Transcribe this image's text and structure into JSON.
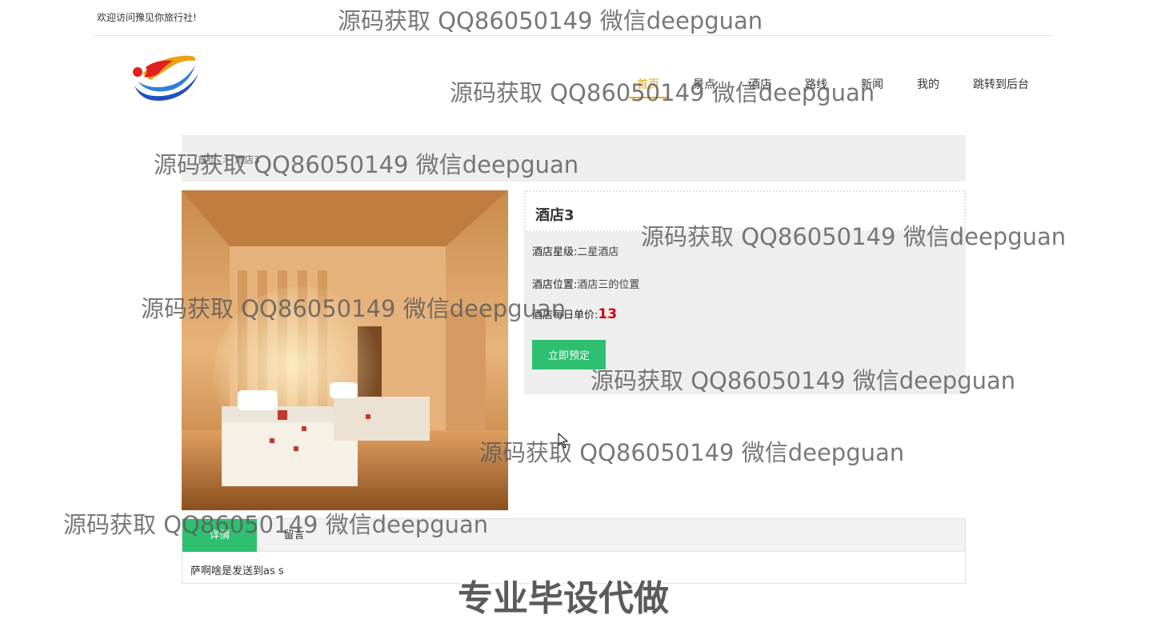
{
  "topbar": {
    "welcome": "欢迎访问豫见你旅行社!"
  },
  "nav": {
    "items": [
      {
        "label": "首页",
        "active": true
      },
      {
        "label": "景点",
        "active": false
      },
      {
        "label": "酒店",
        "active": false
      },
      {
        "label": "路线",
        "active": false
      },
      {
        "label": "新闻",
        "active": false
      },
      {
        "label": "我的",
        "active": false
      },
      {
        "label": "跳转到后台",
        "active": false
      }
    ]
  },
  "breadcrumb": {
    "home": "首页",
    "current": "酒店3"
  },
  "hotel": {
    "name": "酒店3",
    "star_label": "酒店星级:",
    "star_value": "二星酒店",
    "location_label": "酒店位置:",
    "location_value": "酒店三的位置",
    "price_label": "酒店每日单价:",
    "price_value": "13",
    "book_button": "立即预定"
  },
  "tabs": {
    "items": [
      {
        "label": "详情",
        "active": true
      },
      {
        "label": "留言",
        "active": false
      }
    ],
    "content": "萨啊啥是发送到as s"
  },
  "watermarks": {
    "text": "源码获取 QQ86050149 微信deepguan",
    "banner": "专业毕设代做"
  },
  "colors": {
    "accent": "#2fbf71",
    "nav_active": "#e6a817",
    "price": "#d40000"
  }
}
